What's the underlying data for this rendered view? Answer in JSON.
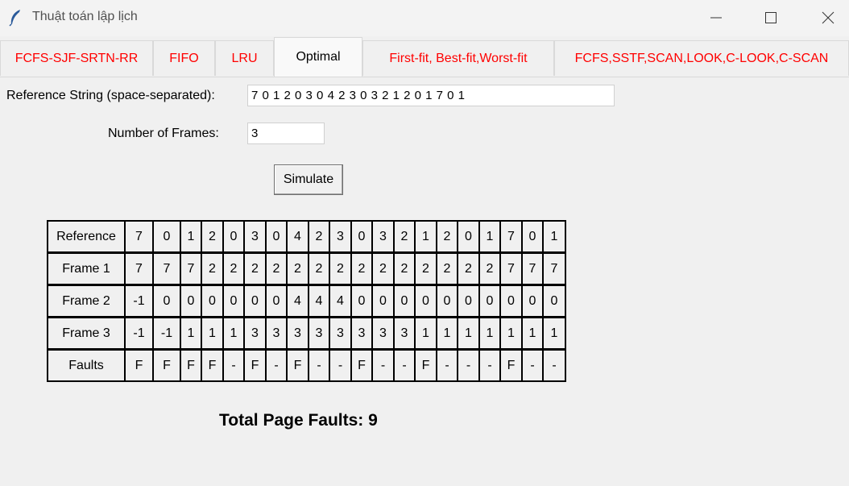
{
  "window": {
    "title": "Thuật toán lập lịch"
  },
  "tabs": [
    {
      "label": "FCFS-SJF-SRTN-RR",
      "active": false
    },
    {
      "label": "FIFO",
      "active": false
    },
    {
      "label": "LRU",
      "active": false
    },
    {
      "label": "Optimal",
      "active": true
    },
    {
      "label": "First-fit, Best-fit,Worst-fit",
      "active": false
    },
    {
      "label": "FCFS,SSTF,SCAN,LOOK,C-LOOK,C-SCAN",
      "active": false
    }
  ],
  "colors": {
    "inactive_tab_text": "#ff0000",
    "active_tab_text": "#000000",
    "background": "#f0f0f0"
  },
  "form": {
    "reference_label": "Reference String (space-separated):",
    "reference_value": "7 0 1 2 0 3 0 4 2 3 0 3 2 1 2 0 1 7 0 1",
    "frames_label": "Number of Frames:",
    "frames_value": "3",
    "simulate_label": "Simulate"
  },
  "table": {
    "rows": [
      {
        "header": "Reference",
        "cells": [
          "7",
          "0",
          "1",
          "2",
          "0",
          "3",
          "0",
          "4",
          "2",
          "3",
          "0",
          "3",
          "2",
          "1",
          "2",
          "0",
          "1",
          "7",
          "0",
          "1"
        ]
      },
      {
        "header": "Frame 1",
        "cells": [
          "7",
          "7",
          "7",
          "2",
          "2",
          "2",
          "2",
          "2",
          "2",
          "2",
          "2",
          "2",
          "2",
          "2",
          "2",
          "2",
          "2",
          "7",
          "7",
          "7"
        ]
      },
      {
        "header": "Frame 2",
        "cells": [
          "-1",
          "0",
          "0",
          "0",
          "0",
          "0",
          "0",
          "4",
          "4",
          "4",
          "0",
          "0",
          "0",
          "0",
          "0",
          "0",
          "0",
          "0",
          "0",
          "0"
        ]
      },
      {
        "header": "Frame 3",
        "cells": [
          "-1",
          "-1",
          "1",
          "1",
          "1",
          "3",
          "3",
          "3",
          "3",
          "3",
          "3",
          "3",
          "3",
          "1",
          "1",
          "1",
          "1",
          "1",
          "1",
          "1"
        ]
      },
      {
        "header": "Faults",
        "cells": [
          "F",
          "F",
          "F",
          "F",
          "-",
          "F",
          "-",
          "F",
          "-",
          "-",
          "F",
          "-",
          "-",
          "F",
          "-",
          "-",
          "-",
          "F",
          "-",
          "-"
        ]
      }
    ]
  },
  "result": {
    "total_label": "Total Page Faults: 9"
  },
  "icons": {
    "app": "feather-icon",
    "minimize": "minimize-icon",
    "maximize": "maximize-icon",
    "close": "close-icon"
  }
}
